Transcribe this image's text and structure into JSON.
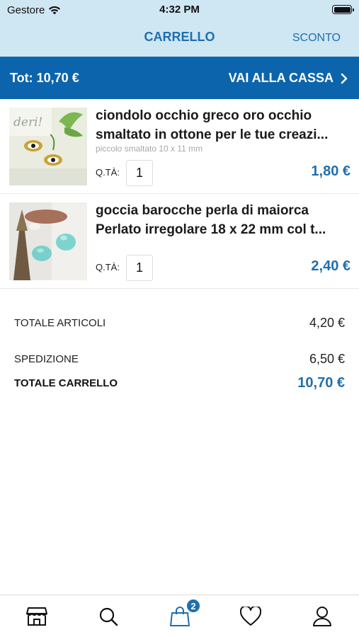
{
  "status_bar": {
    "carrier": "Gestore",
    "time": "4:32 PM"
  },
  "nav": {
    "title": "CARRELLO",
    "action": "SCONTO"
  },
  "checkout_bar": {
    "total": "Tot: 10,70 €",
    "checkout_label": "VAI ALLA CASSA"
  },
  "cart": {
    "items": [
      {
        "name_line1": "ciondolo occhio greco oro occhio",
        "name_line2": "smaltato in ottone per le tue creazi...",
        "variant": "piccolo smaltato 10 x 11 mm",
        "qty_label": "Q.TÀ:",
        "qty": "1",
        "price": "1,80 €"
      },
      {
        "name_line1": "goccia barocche perla di maiorca",
        "name_line2": "Perlato irregolare 18 x 22 mm col t...",
        "variant": "",
        "qty_label": "Q.TÀ:",
        "qty": "1",
        "price": "2,40 €"
      }
    ]
  },
  "totals": {
    "items_label": "TOTALE ARTICOLI",
    "items_value": "4,20 €",
    "shipping_label": "SPEDIZIONE",
    "shipping_value": "6,50 €",
    "cart_total_label": "TOTALE CARRELLO",
    "cart_total_value": "10,70 €"
  },
  "tab_bar": {
    "tabs": [
      {
        "icon": "store-icon"
      },
      {
        "icon": "search-icon"
      },
      {
        "icon": "shopping-bag-icon",
        "badge": "2",
        "active": true
      },
      {
        "icon": "heart-icon"
      },
      {
        "icon": "user-icon"
      }
    ]
  },
  "colors": {
    "accent": "#1f6fae",
    "header_bg": "#cfe6f3",
    "checkout_bg": "#0c65ac"
  }
}
